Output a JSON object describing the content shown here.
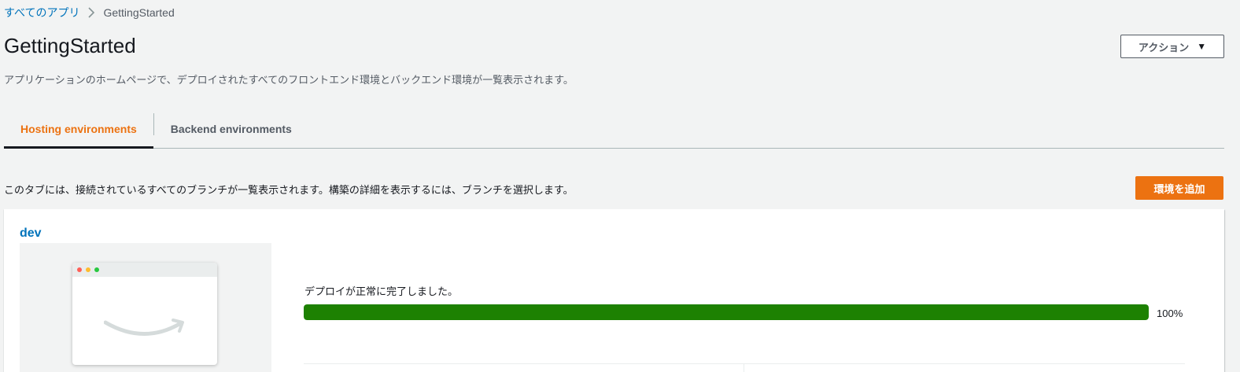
{
  "breadcrumb": {
    "root": "すべてのアプリ",
    "current": "GettingStarted"
  },
  "header": {
    "title": "GettingStarted",
    "description": "アプリケーションのホームページで、デプロイされたすべてのフロントエンド環境とバックエンド環境が一覧表示されます。",
    "actions_label": "アクション"
  },
  "tabs": [
    {
      "label": "Hosting environments",
      "active": true
    },
    {
      "label": "Backend environments",
      "active": false
    }
  ],
  "hosting": {
    "info": "このタブには、接続されているすべてのブランチが一覧表示されます。構築の詳細を表示するには、ブランチを選択します。",
    "add_button": "環境を追加"
  },
  "branch_card": {
    "name": "dev",
    "status": "デプロイが正常に完了しました。",
    "progress": 100,
    "progress_label": "100%"
  },
  "colors": {
    "accent": "#ec7211",
    "link": "#0073bb",
    "success": "#1d8102"
  }
}
